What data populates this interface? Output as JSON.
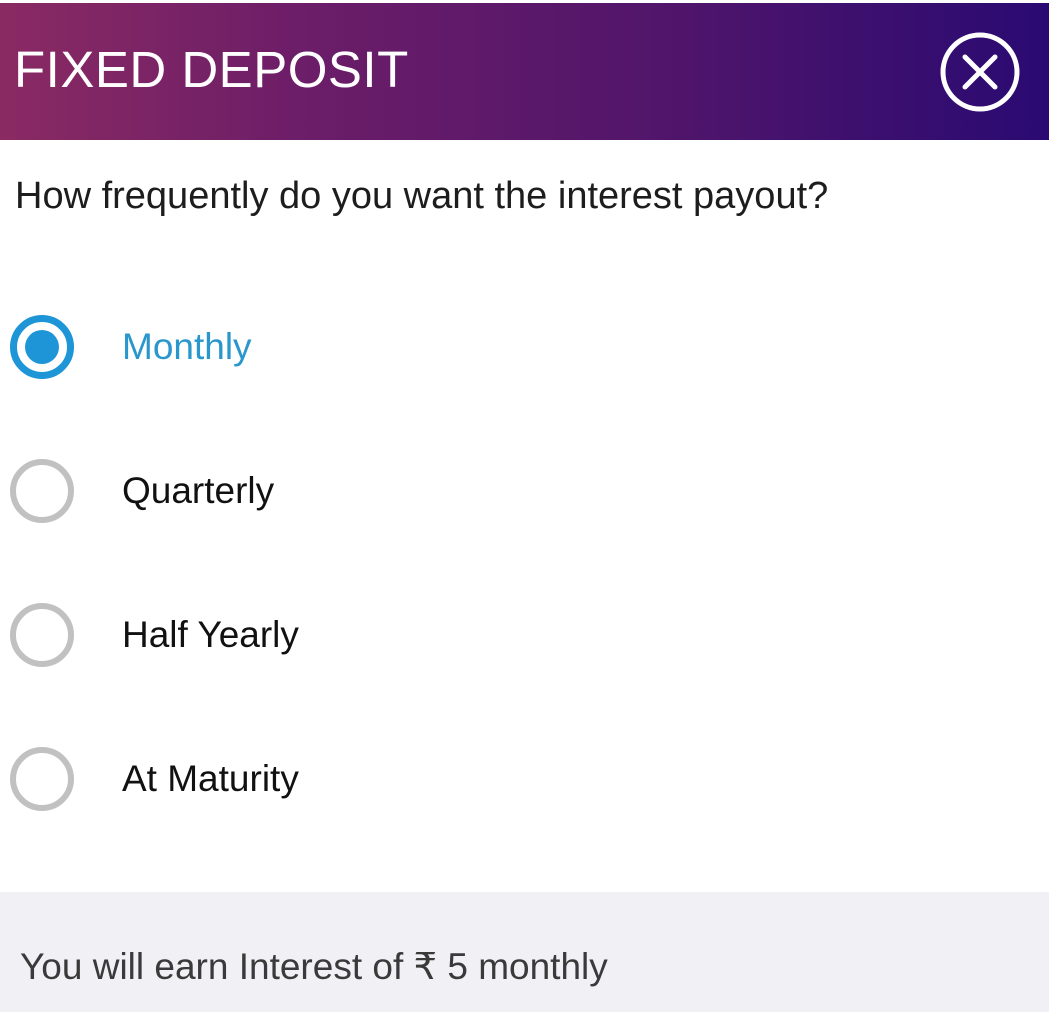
{
  "header": {
    "title": "FIXED DEPOSIT",
    "close_icon": "close-circle-icon",
    "gradient_colors": [
      "#8a2a63",
      "#4f156b",
      "#2a0a72"
    ]
  },
  "question": "How frequently do you want the interest payout?",
  "options": [
    {
      "label": "Monthly",
      "selected": true
    },
    {
      "label": "Quarterly",
      "selected": false
    },
    {
      "label": "Half Yearly",
      "selected": false
    },
    {
      "label": "At Maturity",
      "selected": false
    }
  ],
  "footer": {
    "text": "You will earn Interest of ₹ 5 monthly"
  },
  "colors": {
    "accent": "#1e95d6",
    "selected_label": "#2a97cc",
    "radio_unselected": "#c1c1c1",
    "footer_bg": "#f1f0f5"
  }
}
